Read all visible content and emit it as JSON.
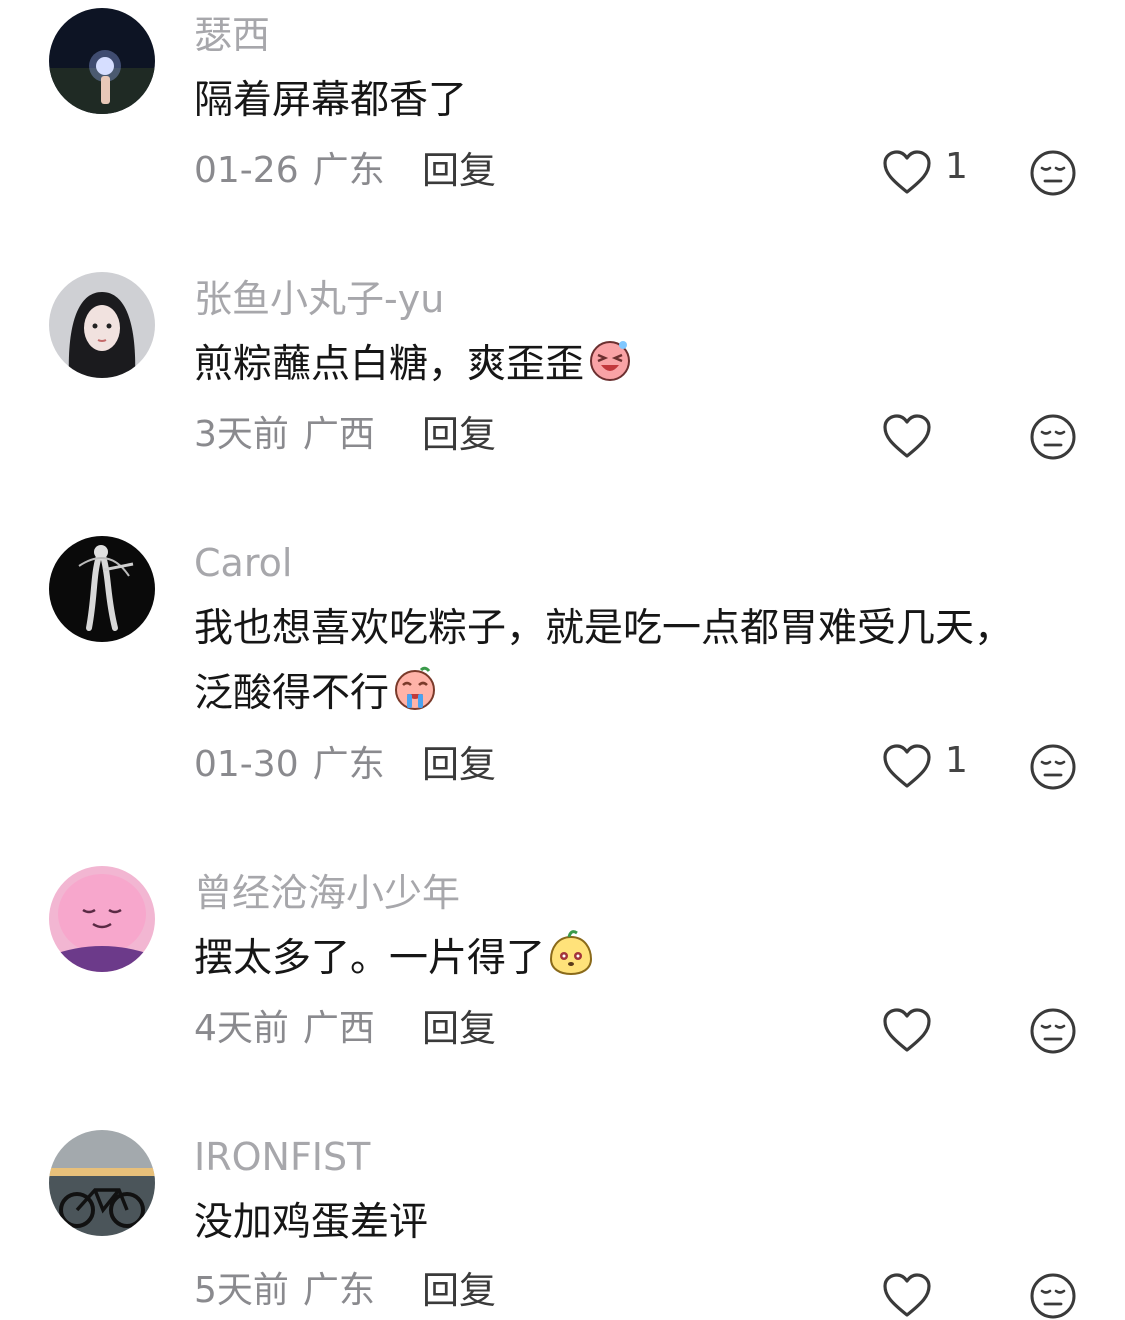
{
  "comments": [
    {
      "user": "瑟西",
      "text": "隔着屏幕都香了",
      "date": "01-26",
      "location": "广东",
      "reply": "回复",
      "likes": "1"
    },
    {
      "user": "张鱼小丸子-yu",
      "text": "煎粽蘸点白糖，爽歪歪",
      "date": "3天前",
      "location": "广西",
      "reply": "回复",
      "likes": ""
    },
    {
      "user": "Carol",
      "text": "我也想喜欢吃粽子，就是吃一点都胃难受几天，泛酸得不行",
      "date": "01-30",
      "location": "广东",
      "reply": "回复",
      "likes": "1"
    },
    {
      "user": "曾经沧海小少年",
      "text": "摆太多了。一片得了",
      "date": "4天前",
      "location": "广西",
      "reply": "回复",
      "likes": ""
    },
    {
      "user": "IRONFIST",
      "text": "没加鸡蛋差评",
      "date": "5天前",
      "location": "广东",
      "reply": "回复",
      "likes": ""
    }
  ],
  "icons": {
    "like": "heart-outline-icon",
    "dislike": "neutral-face-icon"
  },
  "colors": {
    "username": "#a7a7ab",
    "meta": "#8a8a8e",
    "text": "#161616"
  }
}
